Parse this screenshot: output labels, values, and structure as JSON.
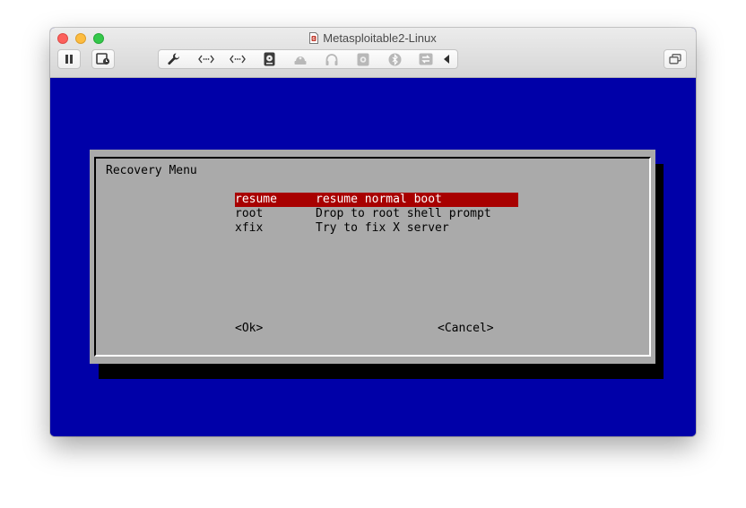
{
  "window": {
    "title": "Metasploitable2-Linux",
    "colors": {
      "screen_bg": "#0000a8",
      "dialog_bg": "#aaaaaa",
      "selection_bg": "#a80000",
      "selection_fg": "#ffffff"
    }
  },
  "toolbar": {
    "pause_icon": "pause-icon",
    "snapshot_icon": "snapshot-icon",
    "device_icons": [
      "wrench-icon",
      "network-adapter-icon",
      "network-adapter-icon",
      "hard-disk-icon",
      "cd-dvd-icon",
      "sound-card-icon",
      "camera-icon",
      "bluetooth-icon",
      "usb-sharing-icon",
      "collapse-arrow-icon"
    ],
    "fullscreen_icon": "fullscreen-icon"
  },
  "recovery": {
    "title": "Recovery Menu",
    "items": [
      {
        "key": "resume",
        "description": "resume normal boot",
        "selected": true
      },
      {
        "key": "root",
        "description": "Drop to root shell prompt",
        "selected": false
      },
      {
        "key": "xfix",
        "description": "Try to fix X server",
        "selected": false
      }
    ],
    "ok_label": "<Ok>",
    "cancel_label": "<Cancel>"
  }
}
